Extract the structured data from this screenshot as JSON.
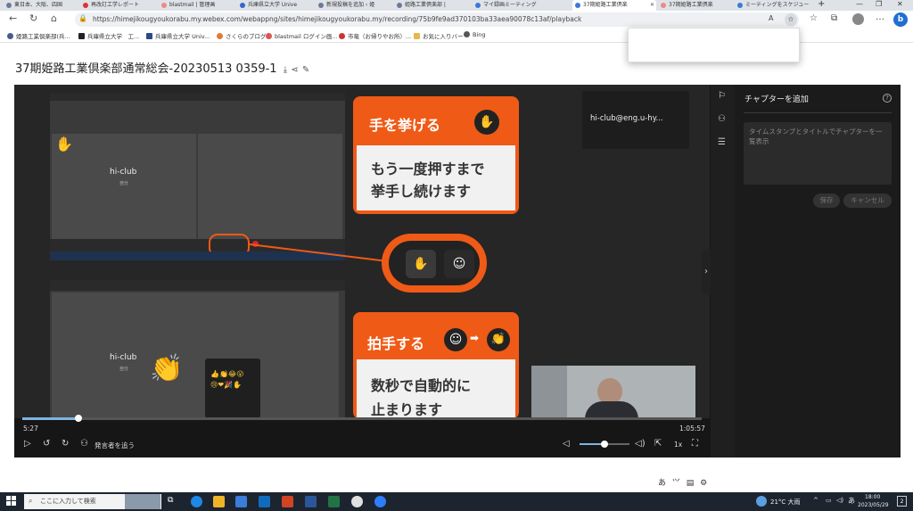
{
  "browser": {
    "tabs": [
      {
        "label": "東日本、大阪、四国",
        "active": false
      },
      {
        "label": "再改訂工学レポート",
        "active": false
      },
      {
        "label": "blastmail | 管理画",
        "active": false
      },
      {
        "label": "兵庫県立大学 Unive",
        "active": false
      },
      {
        "label": "新規投稿を追加 ‹ 姫",
        "active": false
      },
      {
        "label": "姫路工業倶楽部 |",
        "active": false
      },
      {
        "label": "マイ録画ミーティング",
        "active": false
      },
      {
        "label": "37期姫路工業倶楽",
        "active": true
      },
      {
        "label": "37期姫路工業倶楽",
        "active": false
      },
      {
        "label": "ミーティングをスケジュー",
        "active": false
      }
    ],
    "new_tab": "+",
    "url": "https://himejikougyoukorabu.my.webex.com/webappng/sites/himejikougyoukorabu.my/recording/75b9fe9ad370103ba33aea90078c13af/playback",
    "bookmarks": [
      "姫路工業倶楽部(兵...",
      "兵庫県立大学　工...",
      "兵庫県立大学 Univ...",
      "さくらのブログ",
      "blastmail ログイン画...",
      "市竜（お帰りやお所）...",
      "お気に入りバー",
      "Bing"
    ]
  },
  "page": {
    "title": "37期姫路工業倶楽部通常総会-20230513 0359-1"
  },
  "video": {
    "tile_name_1": "hi-club",
    "tile_sub_1": "自分",
    "tile_name_2": "hi-club",
    "tile_sub_2": "自分",
    "slide_head_1": "手を挙げる",
    "slide_body_1a": "もう一度押すまで",
    "slide_body_1b": "挙手し続けます",
    "slide_head_2": "拍手する",
    "slide_body_2a": "数秒で自動的に",
    "slide_body_2b": "止まります",
    "email": "hi-club@eng.u-hy..."
  },
  "controls": {
    "current_time": "5:27",
    "duration": "1:05:57",
    "progress": 0.083,
    "volume": 0.5,
    "follow_speaker_label": "発言者を追う",
    "speed": "1x"
  },
  "chapters": {
    "title": "チャプターを追加",
    "placeholder": "タイムスタンプとタイトルでチャプターを一覧表示",
    "save": "保存",
    "cancel": "キャンセル"
  },
  "taskbar": {
    "search_placeholder": "ここに入力して検索",
    "weather": "21°C 大雨",
    "ime_mode": "あ",
    "time": "18:00",
    "date": "2023/05/29",
    "notifications": "2"
  },
  "ime_toolbar": {
    "mode": "あ"
  }
}
